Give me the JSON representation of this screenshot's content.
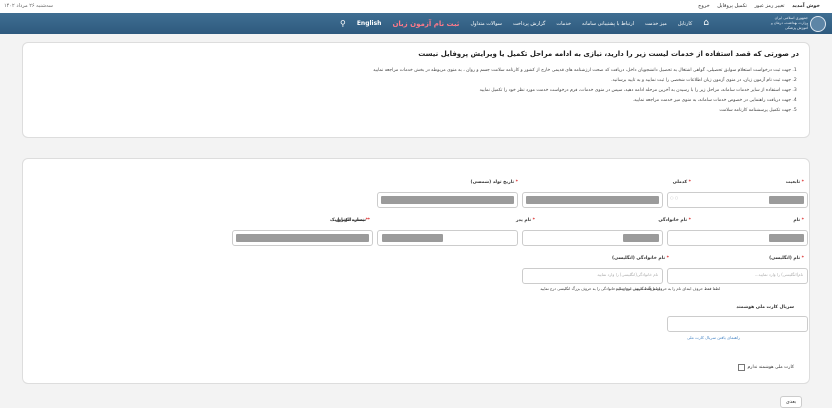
{
  "topbar": {
    "welcome": "خوش آمدید",
    "change_password": "تغییر رمز عبور",
    "complete_profile": "تکمیل پروفایل",
    "logout": "خروج",
    "date": "سه‌شنبه ۲۶ مرداد ۱۴۰۲"
  },
  "logo": {
    "line1": "جمهوری اسلامی ایران",
    "line2": "وزارت بهداشت، درمان و",
    "line3": "آموزش پزشکی"
  },
  "nav": {
    "dashboard": "کارتابل",
    "my_services": "میز خدمت",
    "contact": "ارتباط با پشتیبانی سامانه",
    "services": "خدمات",
    "payment_report": "گزارش پرداخت",
    "faq": "سوالات متداول",
    "register_exam": "ثبت نام آزمون زبان",
    "english": "English"
  },
  "notice": {
    "title": "در صورتی که قصد استفاده از خدمات لیست زیر را دارید، نیازی به ادامه مراحل تکمیل یا ویرایش پروفایل نیست",
    "items": [
      "جهت ثبت درخواست استعلام سوابق تحصیلی، گواهی اشتغال به تحصیل دانشجویان داخل، دریافت کد صحت ارزشنامه های قدیمی خارج از کشور و کارنامه سلامت جسم و روان ، به منوی مربوطه در بخش خدمات مراجعه نمایید",
      "جهت ثبت نام آزمون زبان، در منوی آزمون زبان اطلاعات شخصی را ثبت نمایید و به تایید برسانید.",
      "جهت استفاده از سایر خدمات سامانه، مراحل زیر را با رسیدن به آخرین مرحله ادامه دهید، سپس در منوی خدمات، فرم درخواست خدمت مورد نظر خود را تکمیل نمایید",
      "جهت دریافت راهنمایی در خصوص خدمات سامانه، به منوی میز خدمت مراجعه نمایید.",
      "جهت تکمیل پرسشنامه کارنامه سلامت"
    ]
  },
  "form": {
    "nationality_label": "تابعیت",
    "national_code_label": "کدملی",
    "birth_date_label": "تاریخ تولد (شمسی)",
    "first_name_label": "نام",
    "last_name_label": "نام خانوادگی",
    "father_name_label": "نام پدر",
    "mobile_label": "شماره موبایل",
    "email_label": "پست الکترونیک",
    "first_name_en_label": "نام (انگلیسی)",
    "first_name_en_placeholder": "نام(انگلیسی) را وارد نمایید...",
    "first_name_en_hint": "لطفا فقط حروف ابتدای نام را به حروف بزرگ انگلیسی درج نمایید",
    "last_name_en_label": "نام خانوادگی (انگلیسی)",
    "last_name_en_placeholder": "نام خانوادگی(انگلیسی) را وارد نمایید",
    "last_name_en_hint": "لطفا فقط حروف ابتدای نام خانوادگی را به حروف بزرگ انگلیسی درج نمایید",
    "serial_label": "سریال کارت ملی هوشمند",
    "serial_link": "راهنمای یافتن سریال کارت ملی",
    "no_smart_card": "کارت ملی هوشمند ندارم",
    "radio_mark": "○ ○"
  },
  "footer": {
    "previous": "بعدی"
  }
}
